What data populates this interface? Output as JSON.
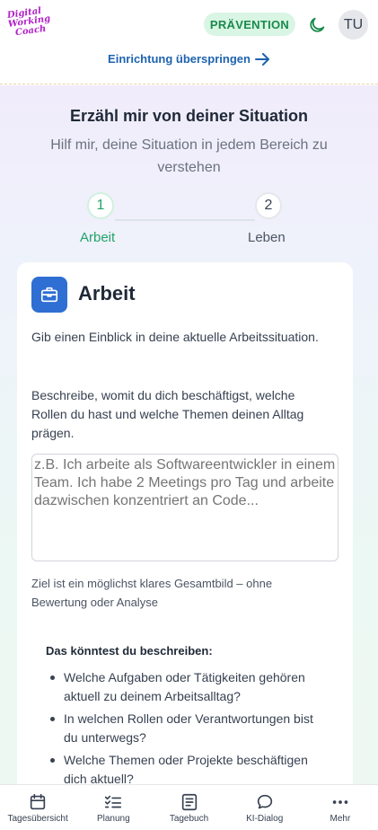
{
  "header": {
    "logo_lines": [
      "Digital",
      "Working",
      "Coach"
    ],
    "badge": "PRÄVENTION",
    "avatar": "TU",
    "skip_link": "Einrichtung überspringen"
  },
  "intro": {
    "title": "Erzähl mir von deiner Situation",
    "subtitle": "Hilf mir, deine Situation in jedem Bereich zu verstehen"
  },
  "stepper": {
    "steps": [
      {
        "number": "1",
        "label": "Arbeit",
        "active": true
      },
      {
        "number": "2",
        "label": "Leben",
        "active": false
      }
    ]
  },
  "card": {
    "title": "Arbeit",
    "intro": "Gib einen Einblick in deine aktuelle Arbeitssituation.",
    "description": "Beschreibe, womit du dich beschäftigst, welche Rollen du hast und welche Themen deinen Alltag prägen.",
    "textarea_placeholder": "z.B. Ich arbeite als Softwareentwickler in einem Team. Ich habe 2 Meetings pro Tag und arbeite dazwischen konzentriert an Code...",
    "hint": "Ziel ist ein möglichst klares Gesamtbild – ohne Bewertung oder Analyse",
    "suggestions_title": "Das könntest du beschreiben:",
    "suggestions": [
      "Welche Aufgaben oder Tätigkeiten gehören aktuell zu deinem Arbeitsalltag?",
      "In welchen Rollen oder Verantwortungen bist du unterwegs?",
      "Welche Themen oder Projekte beschäftigen dich aktuell?"
    ]
  },
  "nav": {
    "items": [
      {
        "label": "Tagesübersicht",
        "icon": "calendar-icon"
      },
      {
        "label": "Planung",
        "icon": "checklist-icon"
      },
      {
        "label": "Tagebuch",
        "icon": "journal-icon"
      },
      {
        "label": "KI-Dialog",
        "icon": "chat-icon"
      },
      {
        "label": "Mehr",
        "icon": "more-icon"
      }
    ]
  },
  "colors": {
    "accent_green": "#22a36a",
    "badge_bg": "#d9f5e4",
    "link_blue": "#1e63b0",
    "card_icon_blue": "#2f6ed3",
    "logo_magenta": "#b120c8"
  }
}
